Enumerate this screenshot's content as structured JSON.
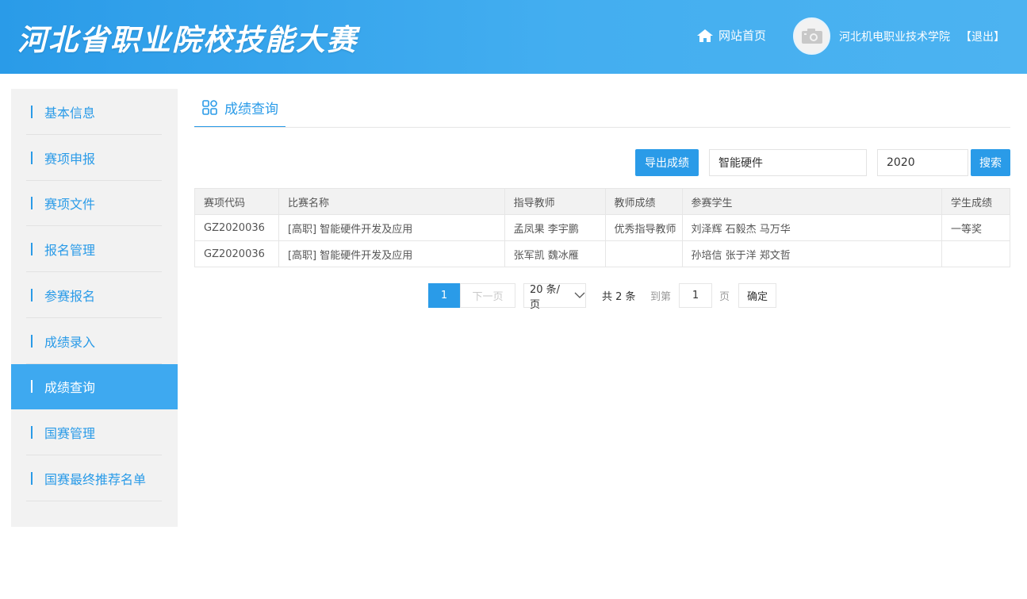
{
  "header": {
    "site_title": "河北省职业院校技能大赛",
    "home_label": "网站首页",
    "user_name": "河北机电职业技术学院",
    "logout_label": "【退出】"
  },
  "sidebar": {
    "items": [
      {
        "label": "基本信息",
        "active": false
      },
      {
        "label": "赛项申报",
        "active": false
      },
      {
        "label": "赛项文件",
        "active": false
      },
      {
        "label": "报名管理",
        "active": false
      },
      {
        "label": "参赛报名",
        "active": false
      },
      {
        "label": "成绩录入",
        "active": false
      },
      {
        "label": "成绩查询",
        "active": true
      },
      {
        "label": "国赛管理",
        "active": false
      },
      {
        "label": "国赛最终推荐名单",
        "active": false
      }
    ]
  },
  "main": {
    "tab_label": "成绩查询",
    "toolbar": {
      "export_label": "导出成绩",
      "keyword_value": "智能硬件",
      "year_value": "2020",
      "search_label": "搜索"
    },
    "table": {
      "headers": [
        "赛项代码",
        "比赛名称",
        "指导教师",
        "教师成绩",
        "参赛学生",
        "学生成绩"
      ],
      "rows": [
        [
          "GZ2020036",
          "[高职] 智能硬件开发及应用",
          "孟凤果 李宇鹏",
          "优秀指导教师",
          "刘泽辉 石毅杰 马万华",
          "一等奖"
        ],
        [
          "GZ2020036",
          "[高职] 智能硬件开发及应用",
          "张军凯 魏冰雁",
          "",
          "孙培信 张于洋 郑文哲",
          ""
        ]
      ]
    },
    "pagination": {
      "current_page": "1",
      "next_label": "下一页",
      "page_size_label": "20 条/页",
      "total_label": "共 2 条",
      "goto_label": "到第",
      "goto_value": "1",
      "page_suffix": "页",
      "confirm_label": "确定"
    }
  },
  "colors": {
    "accent": "#2a9be8",
    "active_item_bg": "#3ea9f0",
    "sidebar_bg": "#f2f2f2"
  }
}
